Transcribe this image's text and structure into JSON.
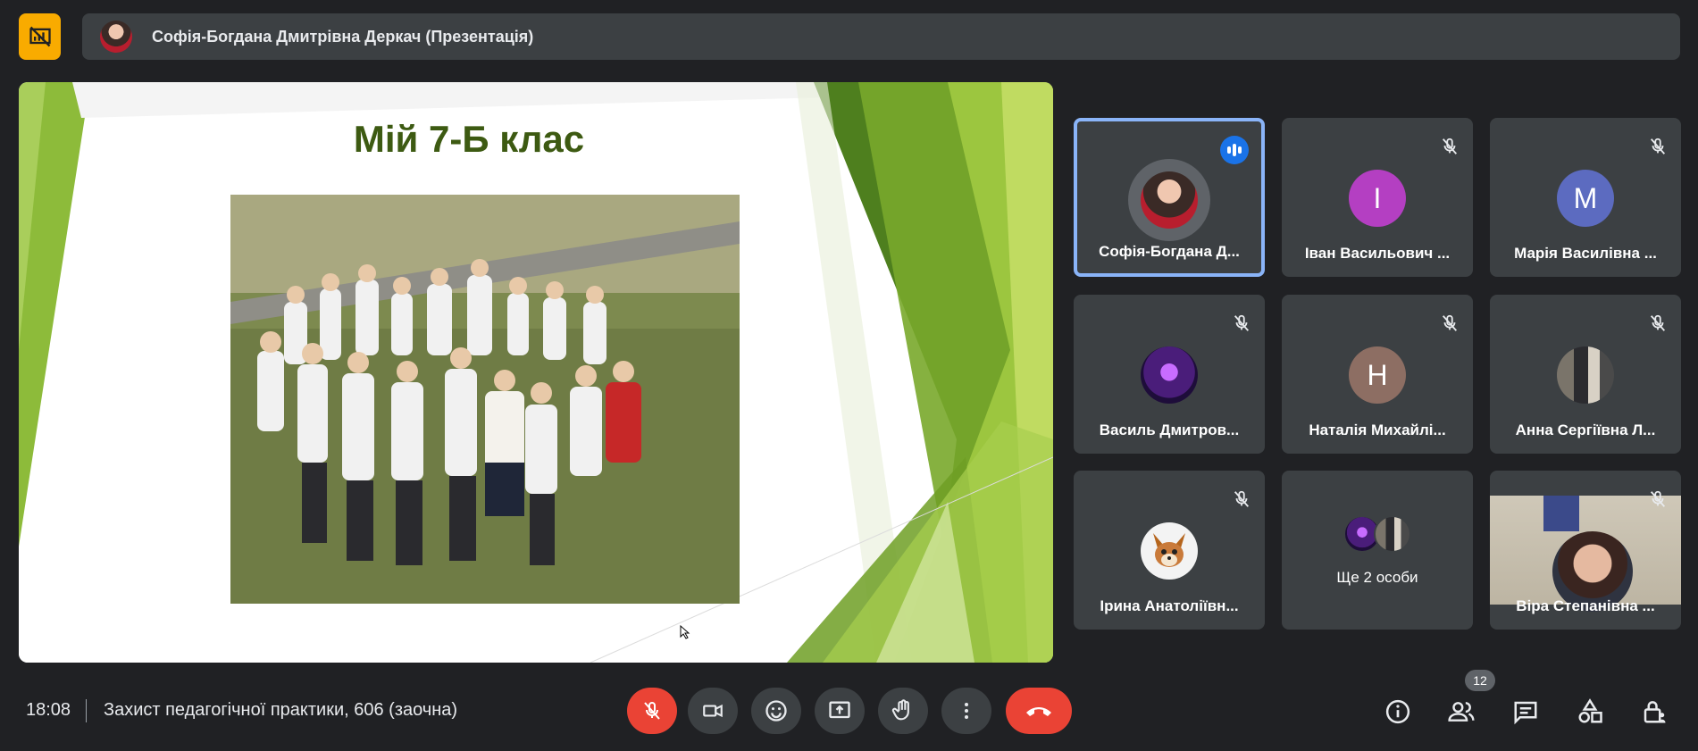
{
  "presenter_bar": {
    "name": "Софія-Богдана Дмитрівна Деркач (Презентація)"
  },
  "slide": {
    "title": "Мій 7-Б клас"
  },
  "participants": [
    {
      "name": "Софія-Богдана Д...",
      "initial": "",
      "muted": false,
      "speaking": true,
      "avatar_color": "#5f6368"
    },
    {
      "name": "Іван Васильович ...",
      "initial": "І",
      "muted": true,
      "speaking": false,
      "avatar_color": "#b43fc2"
    },
    {
      "name": "Марія Василівна ...",
      "initial": "М",
      "muted": true,
      "speaking": false,
      "avatar_color": "#5c6bc0"
    },
    {
      "name": "Василь Дмитров...",
      "initial": "",
      "muted": true,
      "speaking": false,
      "avatar_color": "#3a1f5c"
    },
    {
      "name": "Наталія Михайлі...",
      "initial": "Н",
      "muted": true,
      "speaking": false,
      "avatar_color": "#8d6e63"
    },
    {
      "name": "Анна Сергіївна Л...",
      "initial": "",
      "muted": true,
      "speaking": false,
      "avatar_color": "#6d6a63"
    },
    {
      "name": "Ірина Анатоліївн...",
      "initial": "",
      "muted": true,
      "speaking": false,
      "avatar_color": "#f3f3f3"
    },
    {
      "name": "Віра Степанівна ...",
      "initial": "",
      "muted": true,
      "speaking": false,
      "avatar_color": "#c9c3b8"
    }
  ],
  "more_tile": {
    "label": "Ще 2 особи"
  },
  "bottom_bar": {
    "time": "18:08",
    "meeting_title": "Захист педагогічної практики, 606 (заочна)",
    "participants_count": "12"
  },
  "colors": {
    "background": "#202124",
    "tile": "#3c4043",
    "accent": "#8ab4f8",
    "danger": "#ea4335",
    "logo": "#f9ab00"
  }
}
